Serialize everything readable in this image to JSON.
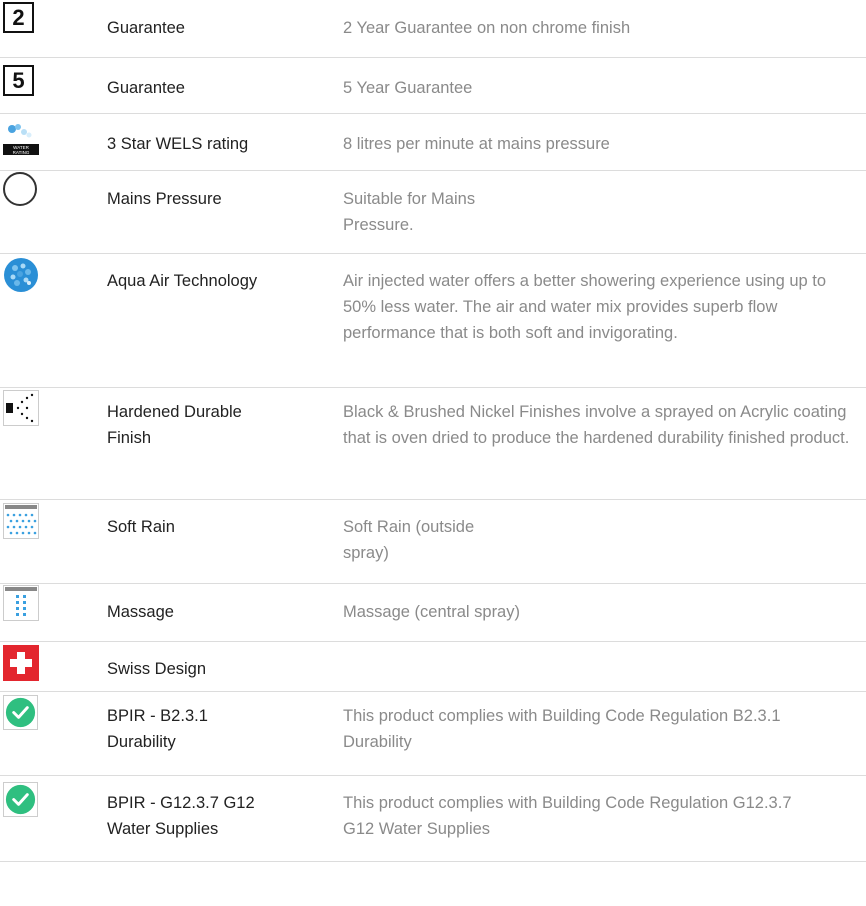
{
  "rows": [
    {
      "icon": "number-2-icon",
      "icon_text": "2",
      "title": "Guarantee",
      "desc": "2 Year Guarantee on non chrome finish"
    },
    {
      "icon": "number-5-icon",
      "icon_text": "5",
      "title": "Guarantee",
      "desc": "5 Year Guarantee"
    },
    {
      "icon": "water-rating-icon",
      "icon_text": "WATER RATING",
      "title": "3 Star WELS rating",
      "desc": "8 litres per minute at mains pressure"
    },
    {
      "icon": "circle-outline-icon",
      "title": "Mains Pressure",
      "desc": "Suitable for Mains Pressure."
    },
    {
      "icon": "water-bubble-icon",
      "title": "Aqua Air Technology",
      "desc": "Air injected water offers a better showering experience using up to 50% less water. The air and water mix provides superb flow performance that is both soft and invigorating."
    },
    {
      "icon": "spray-dots-icon",
      "title": "Hardened Durable Finish",
      "desc": "Black & Brushed Nickel Finishes involve a sprayed on Acrylic coating that is oven dried to produce the hardened durability finished product."
    },
    {
      "icon": "soft-rain-icon",
      "title": "Soft Rain",
      "desc": "Soft Rain (outside spray)"
    },
    {
      "icon": "massage-spray-icon",
      "title": "Massage",
      "desc": "Massage (central spray)"
    },
    {
      "icon": "swiss-cross-icon",
      "title": "Swiss Design",
      "desc": ""
    },
    {
      "icon": "check-circle-icon",
      "title": "BPIR - B2.3.1 Durability",
      "desc": "This product complies with Building Code Regulation B2.3.1 Durability"
    },
    {
      "icon": "check-circle-icon",
      "title": "BPIR - G12.3.7 G12 Water Supplies",
      "desc": "This product complies with Building Code Regulation G12.3.7 G12 Water Supplies"
    }
  ],
  "colors": {
    "title_text": "#222222",
    "desc_text": "#8a8a8a",
    "divider": "#dcdcdc",
    "check_green": "#2fbf80",
    "swiss_red": "#e3262e",
    "water_blue": "#2a8fd6"
  }
}
